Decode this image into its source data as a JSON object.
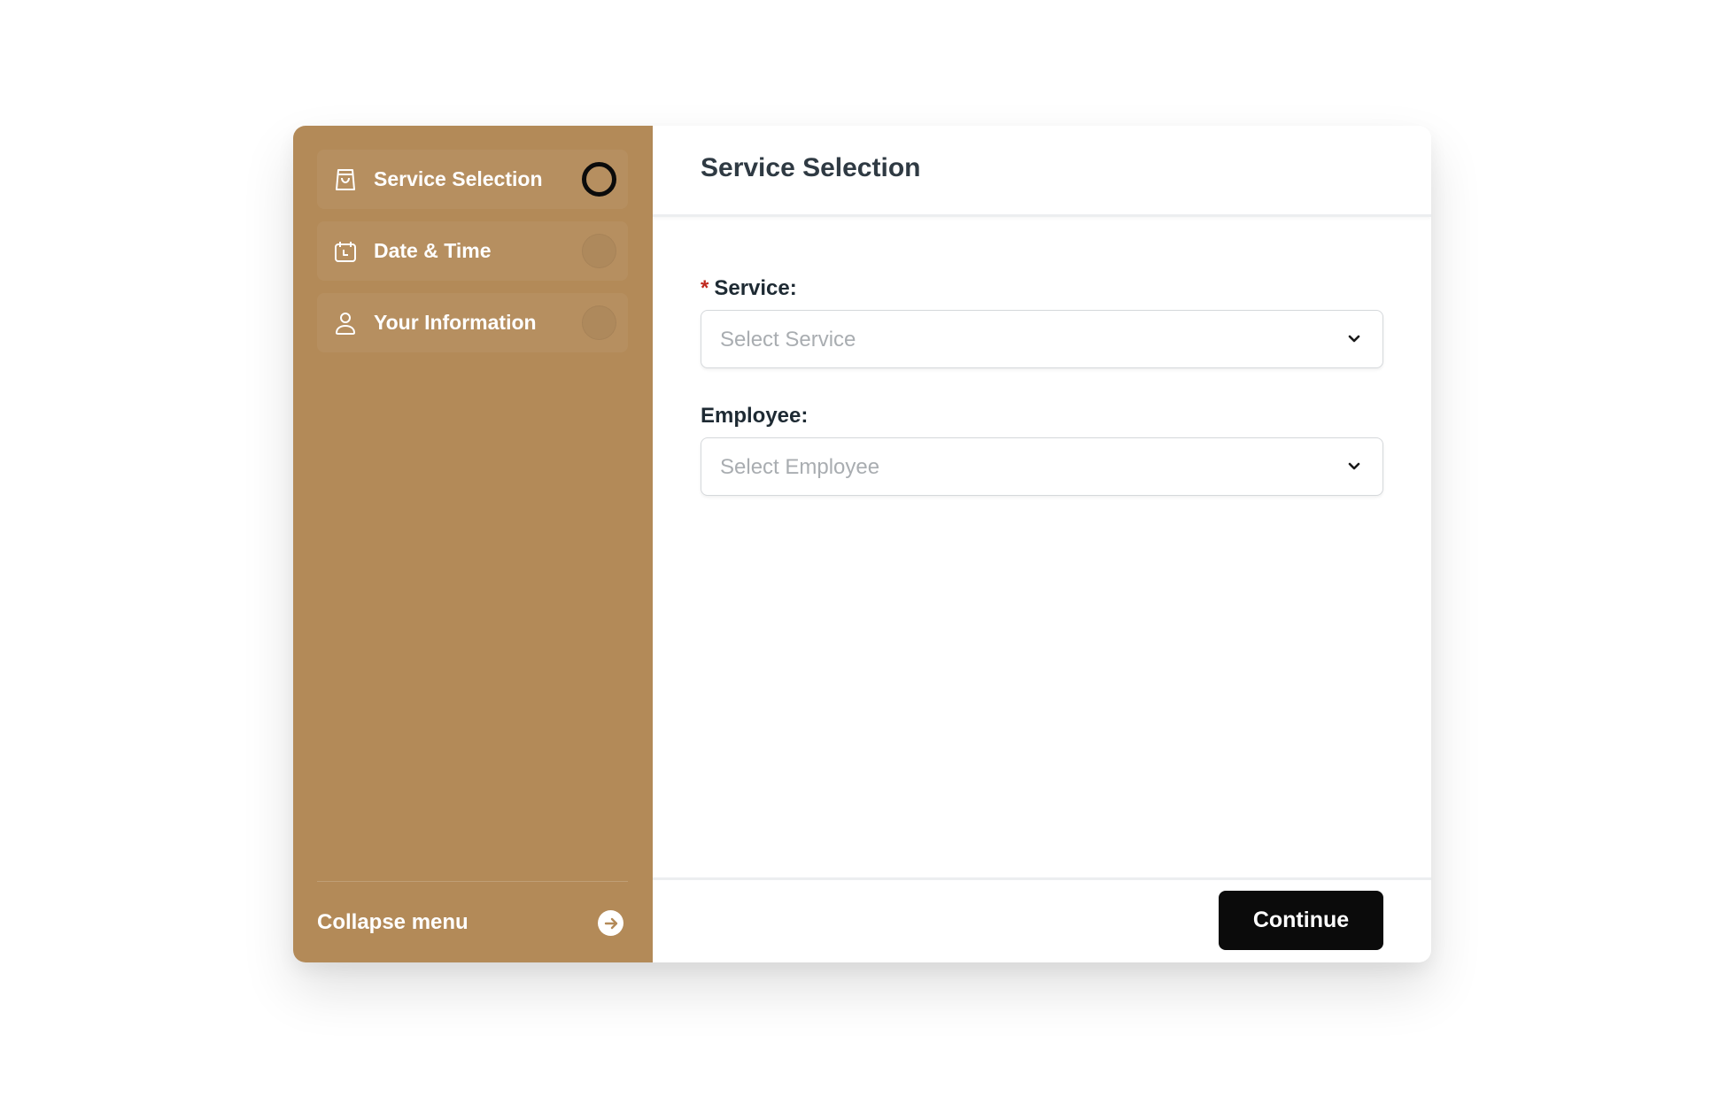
{
  "sidebar": {
    "items": [
      {
        "label": "Service Selection",
        "icon": "shopping-bag-icon",
        "status": "active"
      },
      {
        "label": "Date & Time",
        "icon": "calendar-icon",
        "status": "pending"
      },
      {
        "label": "Your Information",
        "icon": "user-icon",
        "status": "pending"
      }
    ],
    "collapse_label": "Collapse menu",
    "collapse_icon": "arrow-right-circle-icon"
  },
  "main": {
    "title": "Service Selection",
    "fields": [
      {
        "label": "Service:",
        "required": true,
        "required_marker": "*",
        "placeholder": "Select Service"
      },
      {
        "label": "Employee:",
        "required": false,
        "placeholder": "Select Employee"
      }
    ],
    "continue_label": "Continue"
  },
  "colors": {
    "sidebar_bg": "#b38a58",
    "primary_button": "#0b0b0b",
    "required": "#c0281e"
  }
}
